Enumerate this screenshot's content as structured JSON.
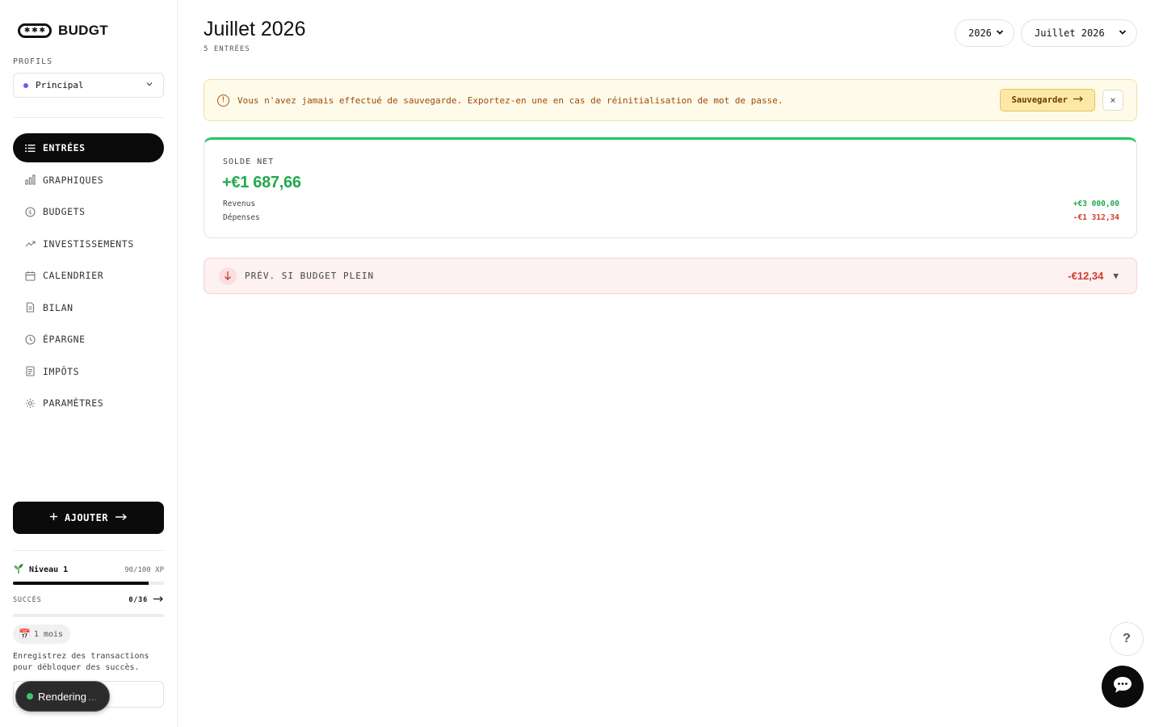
{
  "sidebar": {
    "logo_text": "BUDGT",
    "profiles_label": "PROFILS",
    "profile_selected": "Principal",
    "nav": [
      {
        "label": "ENTRÉES",
        "icon": "list-icon",
        "active": true
      },
      {
        "label": "GRAPHIQUES",
        "icon": "bar-chart-icon",
        "active": false
      },
      {
        "label": "BUDGETS",
        "icon": "coin-icon",
        "active": false
      },
      {
        "label": "INVESTISSEMENTS",
        "icon": "trending-up-icon",
        "active": false
      },
      {
        "label": "CALENDRIER",
        "icon": "calendar-icon",
        "active": false
      },
      {
        "label": "BILAN",
        "icon": "document-icon",
        "active": false
      },
      {
        "label": "ÉPARGNE",
        "icon": "clock-icon",
        "active": false
      },
      {
        "label": "IMPÔTS",
        "icon": "receipt-icon",
        "active": false
      },
      {
        "label": "PARAMÈTRES",
        "icon": "gear-icon",
        "active": false
      }
    ],
    "add_button": "AJOUTER",
    "level_label": "Niveau 1",
    "xp_text": "90/100 XP",
    "xp_progress": 0.9,
    "success_label": "SUCCÈS",
    "success_count": "0/36",
    "success_progress": 0,
    "badge_text": "1 mois",
    "hint_text": "Enregistrez des transactions pour débloquer des succès.",
    "toast_text": "Rendering",
    "toast_ellipsis": "..."
  },
  "main": {
    "title": "Juillet 2026",
    "subtitle": "5 ENTRÉES",
    "year_select": "2026",
    "month_select": "Juillet 2026",
    "banner": {
      "message": "Vous n'avez jamais effectué de sauvegarde. Exportez-en une en cas de réinitialisation de mot de passe.",
      "save_label": "Sauvegarder",
      "close_label": "×"
    },
    "solde": {
      "label": "SOLDE NET",
      "value": "+€1 687,66",
      "revenus_label": "Revenus",
      "revenus_value": "+€3 000,00",
      "depenses_label": "Dépenses",
      "depenses_value": "-€1 312,34"
    },
    "prev": {
      "label": "PRÉV. SI BUDGET PLEIN",
      "value": "-€12,34"
    },
    "help_label": "?"
  },
  "colors": {
    "accent_green": "#22c55e",
    "negative_red": "#d13b2b",
    "warning_bg": "#fffbea",
    "profile_dot": "#6a5cf0"
  }
}
